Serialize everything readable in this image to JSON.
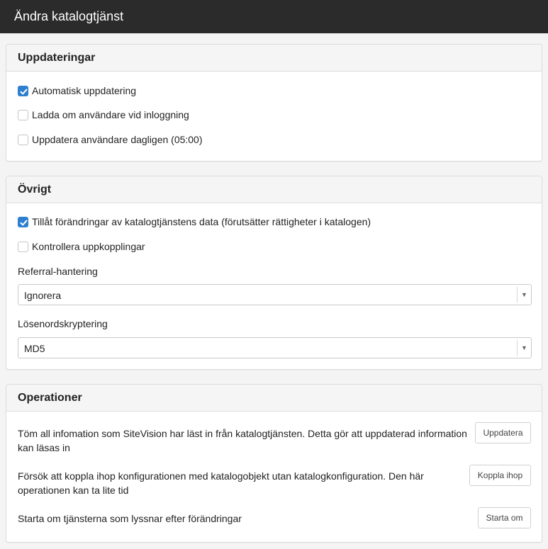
{
  "window": {
    "title": "Ändra katalogtjänst"
  },
  "updates": {
    "header": "Uppdateringar",
    "items": [
      {
        "label": "Automatisk uppdatering",
        "checked": true
      },
      {
        "label": "Ladda om användare vid inloggning",
        "checked": false
      },
      {
        "label": "Uppdatera användare dagligen (05:00)",
        "checked": false
      }
    ]
  },
  "other": {
    "header": "Övrigt",
    "items": [
      {
        "label": "Tillåt förändringar av katalogtjänstens data (förutsätter rättigheter i katalogen)",
        "checked": true
      },
      {
        "label": "Kontrollera uppkopplingar",
        "checked": false
      }
    ],
    "referral": {
      "label": "Referral-hantering",
      "value": "Ignorera"
    },
    "password": {
      "label": "Lösenordskryptering",
      "value": "MD5"
    }
  },
  "operations": {
    "header": "Operationer",
    "items": [
      {
        "text": "Töm all infomation som SiteVision har läst in från katalogtjänsten. Detta gör att uppdaterad information kan läsas in",
        "button": "Uppdatera"
      },
      {
        "text": "Försök att koppla ihop konfigurationen med katalogobjekt utan katalogkonfiguration. Den här operationen kan ta lite tid",
        "button": "Koppla ihop"
      },
      {
        "text": "Starta om tjänsterna som lyssnar efter förändringar",
        "button": "Starta om"
      }
    ]
  },
  "colors": {
    "titlebar": "#2b2b2b",
    "checkbox_accent": "#2e7fd0",
    "panel_header": "#f5f5f5"
  },
  "icons": {
    "check": "checkmark-icon",
    "dropdown": "dropdown-arrow-icon"
  }
}
